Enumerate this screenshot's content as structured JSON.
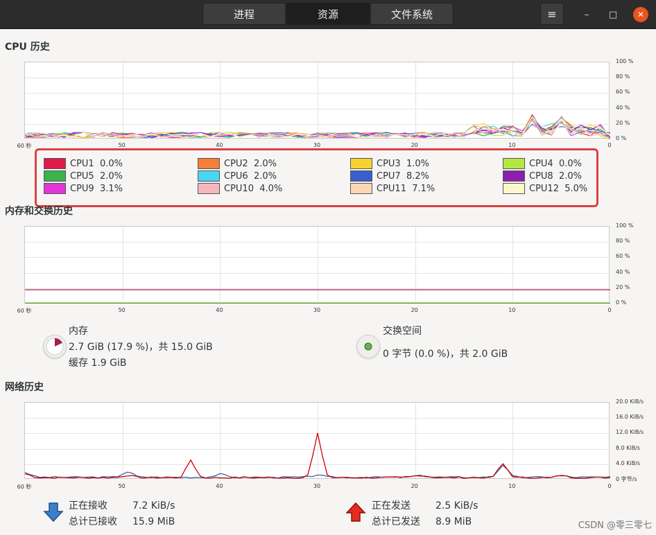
{
  "tabs": [
    "进程",
    "资源",
    "文件系统"
  ],
  "active_tab": 1,
  "window": {
    "menu_icon": "hamburger-icon",
    "minimize": "–",
    "maximize": "□",
    "close": "✕"
  },
  "cpu": {
    "title": "CPU 历史",
    "y_ticks": [
      "100 %",
      "80 %",
      "60 %",
      "40 %",
      "20 %",
      "0 %"
    ],
    "x_ticks": [
      "60 秒",
      "50",
      "40",
      "30",
      "20",
      "10",
      "0"
    ],
    "cores": [
      {
        "label": "CPU1",
        "value": "0.0%",
        "color": "#e01b4c"
      },
      {
        "label": "CPU2",
        "value": "2.0%",
        "color": "#f57f39"
      },
      {
        "label": "CPU3",
        "value": "1.0%",
        "color": "#f6d32d"
      },
      {
        "label": "CPU4",
        "value": "0.0%",
        "color": "#b5e742"
      },
      {
        "label": "CPU5",
        "value": "2.0%",
        "color": "#3bb34a"
      },
      {
        "label": "CPU6",
        "value": "2.0%",
        "color": "#4ad6f0"
      },
      {
        "label": "CPU7",
        "value": "8.2%",
        "color": "#3a5fcd"
      },
      {
        "label": "CPU8",
        "value": "2.0%",
        "color": "#8d1fad"
      },
      {
        "label": "CPU9",
        "value": "3.1%",
        "color": "#e236d8"
      },
      {
        "label": "CPU10",
        "value": "4.0%",
        "color": "#f7b7bf"
      },
      {
        "label": "CPU11",
        "value": "7.1%",
        "color": "#fcd7b6"
      },
      {
        "label": "CPU12",
        "value": "5.0%",
        "color": "#fdf8cc"
      }
    ]
  },
  "memory": {
    "title": "内存和交换历史",
    "y_ticks": [
      "100 %",
      "80 %",
      "60 %",
      "40 %",
      "20 %",
      "0 %"
    ],
    "x_ticks": [
      "60 秒",
      "50",
      "40",
      "30",
      "20",
      "10",
      "0"
    ],
    "mem_label": "内存",
    "mem_usage": "2.7 GiB (17.9 %)，共 15.0 GiB",
    "cache": "缓存 1.9 GiB",
    "mem_percent": 17.9,
    "mem_color": "#a51d57",
    "swap_label": "交换空间",
    "swap_usage": "0 字节 (0.0 %)，共 2.0 GiB",
    "swap_color": "#4e9a06"
  },
  "network": {
    "title": "网络历史",
    "y_ticks": [
      "20.0 KiB/s",
      "16.0 KiB/s",
      "12.0 KiB/s",
      "8.0 KiB/s",
      "4.0 KiB/s",
      "0 字节/s"
    ],
    "x_ticks": [
      "60 秒",
      "50",
      "40",
      "30",
      "20",
      "10",
      "0"
    ],
    "recv_label": "正在接收",
    "recv_rate": "7.2 KiB/s",
    "recv_total_label": "总计已接收",
    "recv_total": "15.9 MiB",
    "send_label": "正在发送",
    "send_rate": "2.5 KiB/s",
    "send_total_label": "总计已发送",
    "send_total": "8.9 MiB",
    "recv_color": "#3465a4",
    "send_color": "#cc0000"
  },
  "watermark": "CSDN @零三零七"
}
